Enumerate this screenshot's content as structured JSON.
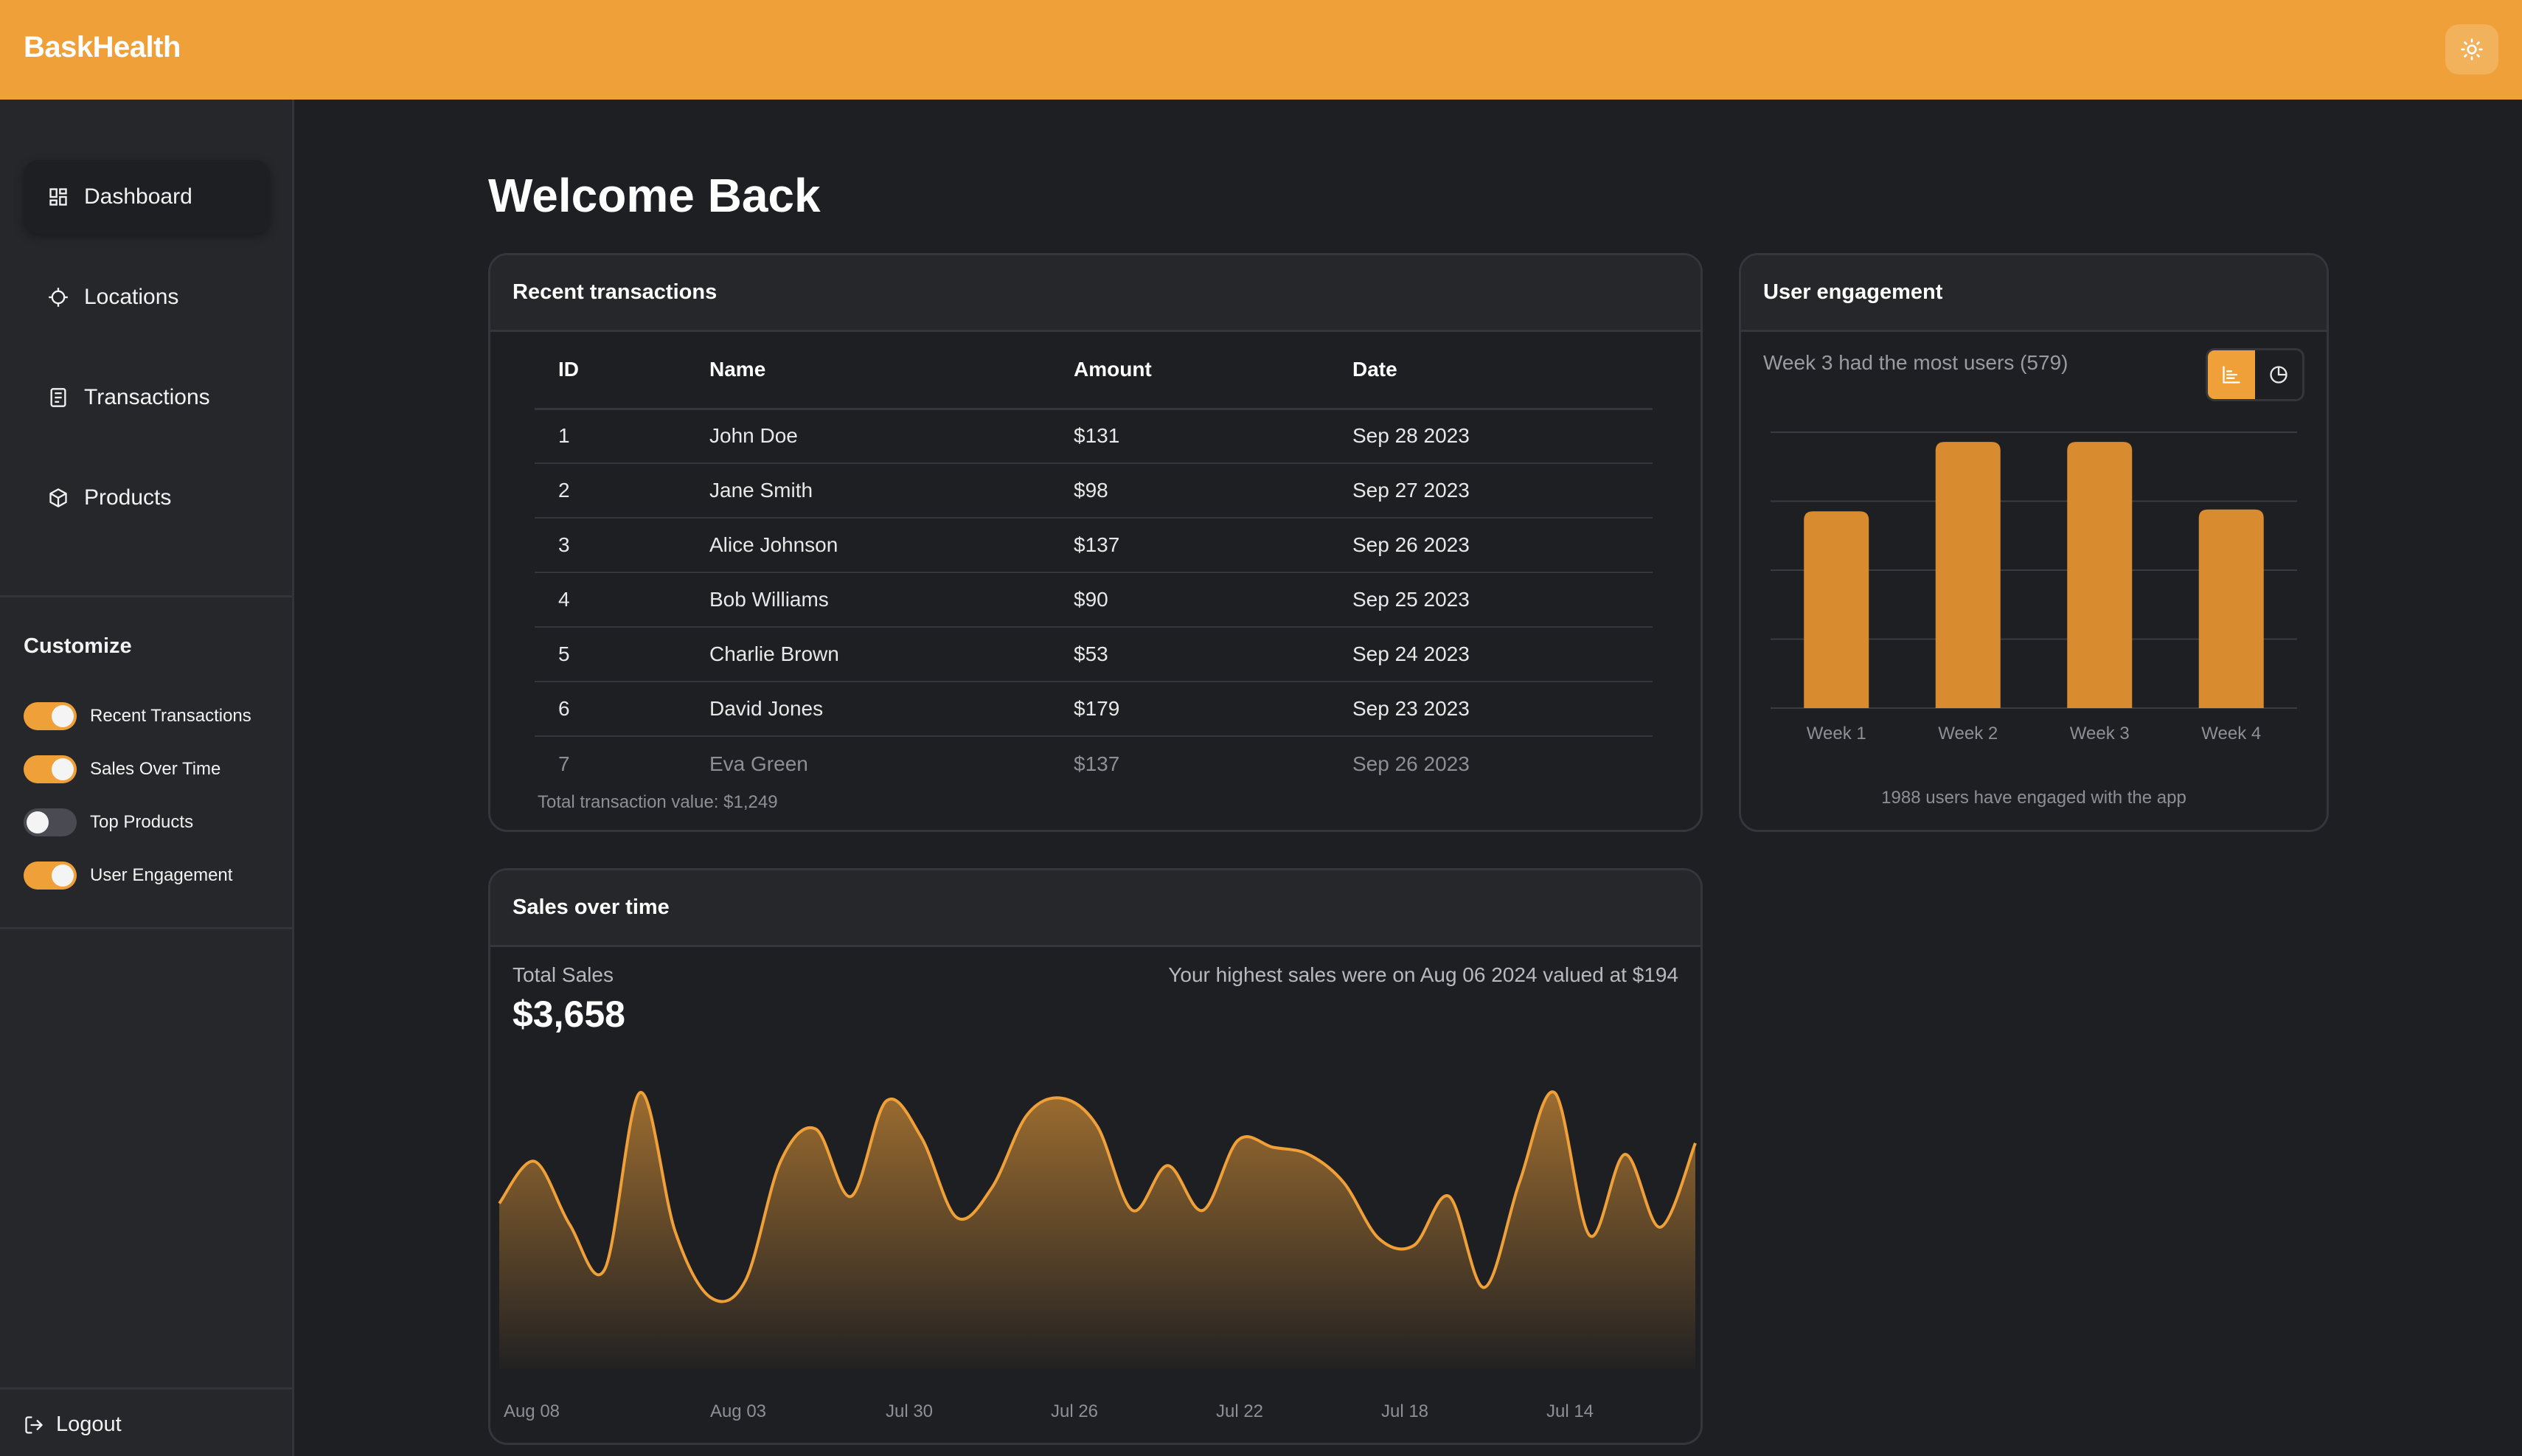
{
  "app": {
    "brand": "BaskHealth",
    "accent_color": "#f0a038",
    "theme_icon": "sun-icon"
  },
  "sidebar": {
    "items": [
      {
        "label": "Dashboard",
        "icon": "dashboard-grid-icon",
        "active": true
      },
      {
        "label": "Locations",
        "icon": "crosshair-icon",
        "active": false
      },
      {
        "label": "Transactions",
        "icon": "receipt-icon",
        "active": false
      },
      {
        "label": "Products",
        "icon": "box-icon",
        "active": false
      }
    ],
    "customize_title": "Customize",
    "toggles": [
      {
        "label": "Recent Transactions",
        "on": true
      },
      {
        "label": "Sales Over Time",
        "on": true
      },
      {
        "label": "Top Products",
        "on": false
      },
      {
        "label": "User Engagement",
        "on": true
      }
    ],
    "logout_label": "Logout"
  },
  "main": {
    "title": "Welcome Back",
    "transactions": {
      "title": "Recent transactions",
      "columns": [
        "ID",
        "Name",
        "Amount",
        "Date"
      ],
      "rows": [
        [
          "1",
          "John Doe",
          "$131",
          "Sep 28 2023"
        ],
        [
          "2",
          "Jane Smith",
          "$98",
          "Sep 27 2023"
        ],
        [
          "3",
          "Alice Johnson",
          "$137",
          "Sep 26 2023"
        ],
        [
          "4",
          "Bob Williams",
          "$90",
          "Sep 25 2023"
        ],
        [
          "5",
          "Charlie Brown",
          "$53",
          "Sep 24 2023"
        ],
        [
          "6",
          "David Jones",
          "$179",
          "Sep 23 2023"
        ],
        [
          "7",
          "Eva Green",
          "$137",
          "Sep 26 2023"
        ]
      ],
      "total_text": "Total transaction value: $1,249"
    },
    "engagement": {
      "title": "User engagement",
      "subtitle": "Week 3 had the most users (579)",
      "view_buttons": [
        {
          "icon": "bar-chart-icon",
          "selected": true
        },
        {
          "icon": "pie-chart-icon",
          "selected": false
        }
      ],
      "footer": "1988 users have engaged with the app"
    },
    "sales": {
      "title": "Sales over time",
      "total_label": "Total Sales",
      "total_value": "$3,658",
      "note": "Your highest sales were on Aug 06 2024 valued at $194"
    }
  },
  "chart_data": [
    {
      "type": "bar",
      "categories": [
        "Week 1",
        "Week 2",
        "Week 3",
        "Week 4"
      ],
      "values": [
        428,
        579,
        579,
        432
      ],
      "ylim": [
        0,
        600
      ],
      "grid": true,
      "color": "#d98b2f"
    },
    {
      "type": "area",
      "x_tick_labels": [
        "Aug 08",
        "Aug 03",
        "Jul 30",
        "Jul 26",
        "Jul 22",
        "Jul 18",
        "Jul 14"
      ],
      "values": [
        115,
        145,
        100,
        68,
        194,
        95,
        48,
        60,
        145,
        168,
        120,
        188,
        162,
        105,
        126,
        178,
        190,
        170,
        110,
        142,
        110,
        160,
        155,
        150,
        130,
        90,
        85,
        120,
        55,
        130,
        194,
        92,
        150,
        98,
        158
      ],
      "ylim": [
        0,
        200
      ],
      "color": "#f0a038"
    }
  ]
}
